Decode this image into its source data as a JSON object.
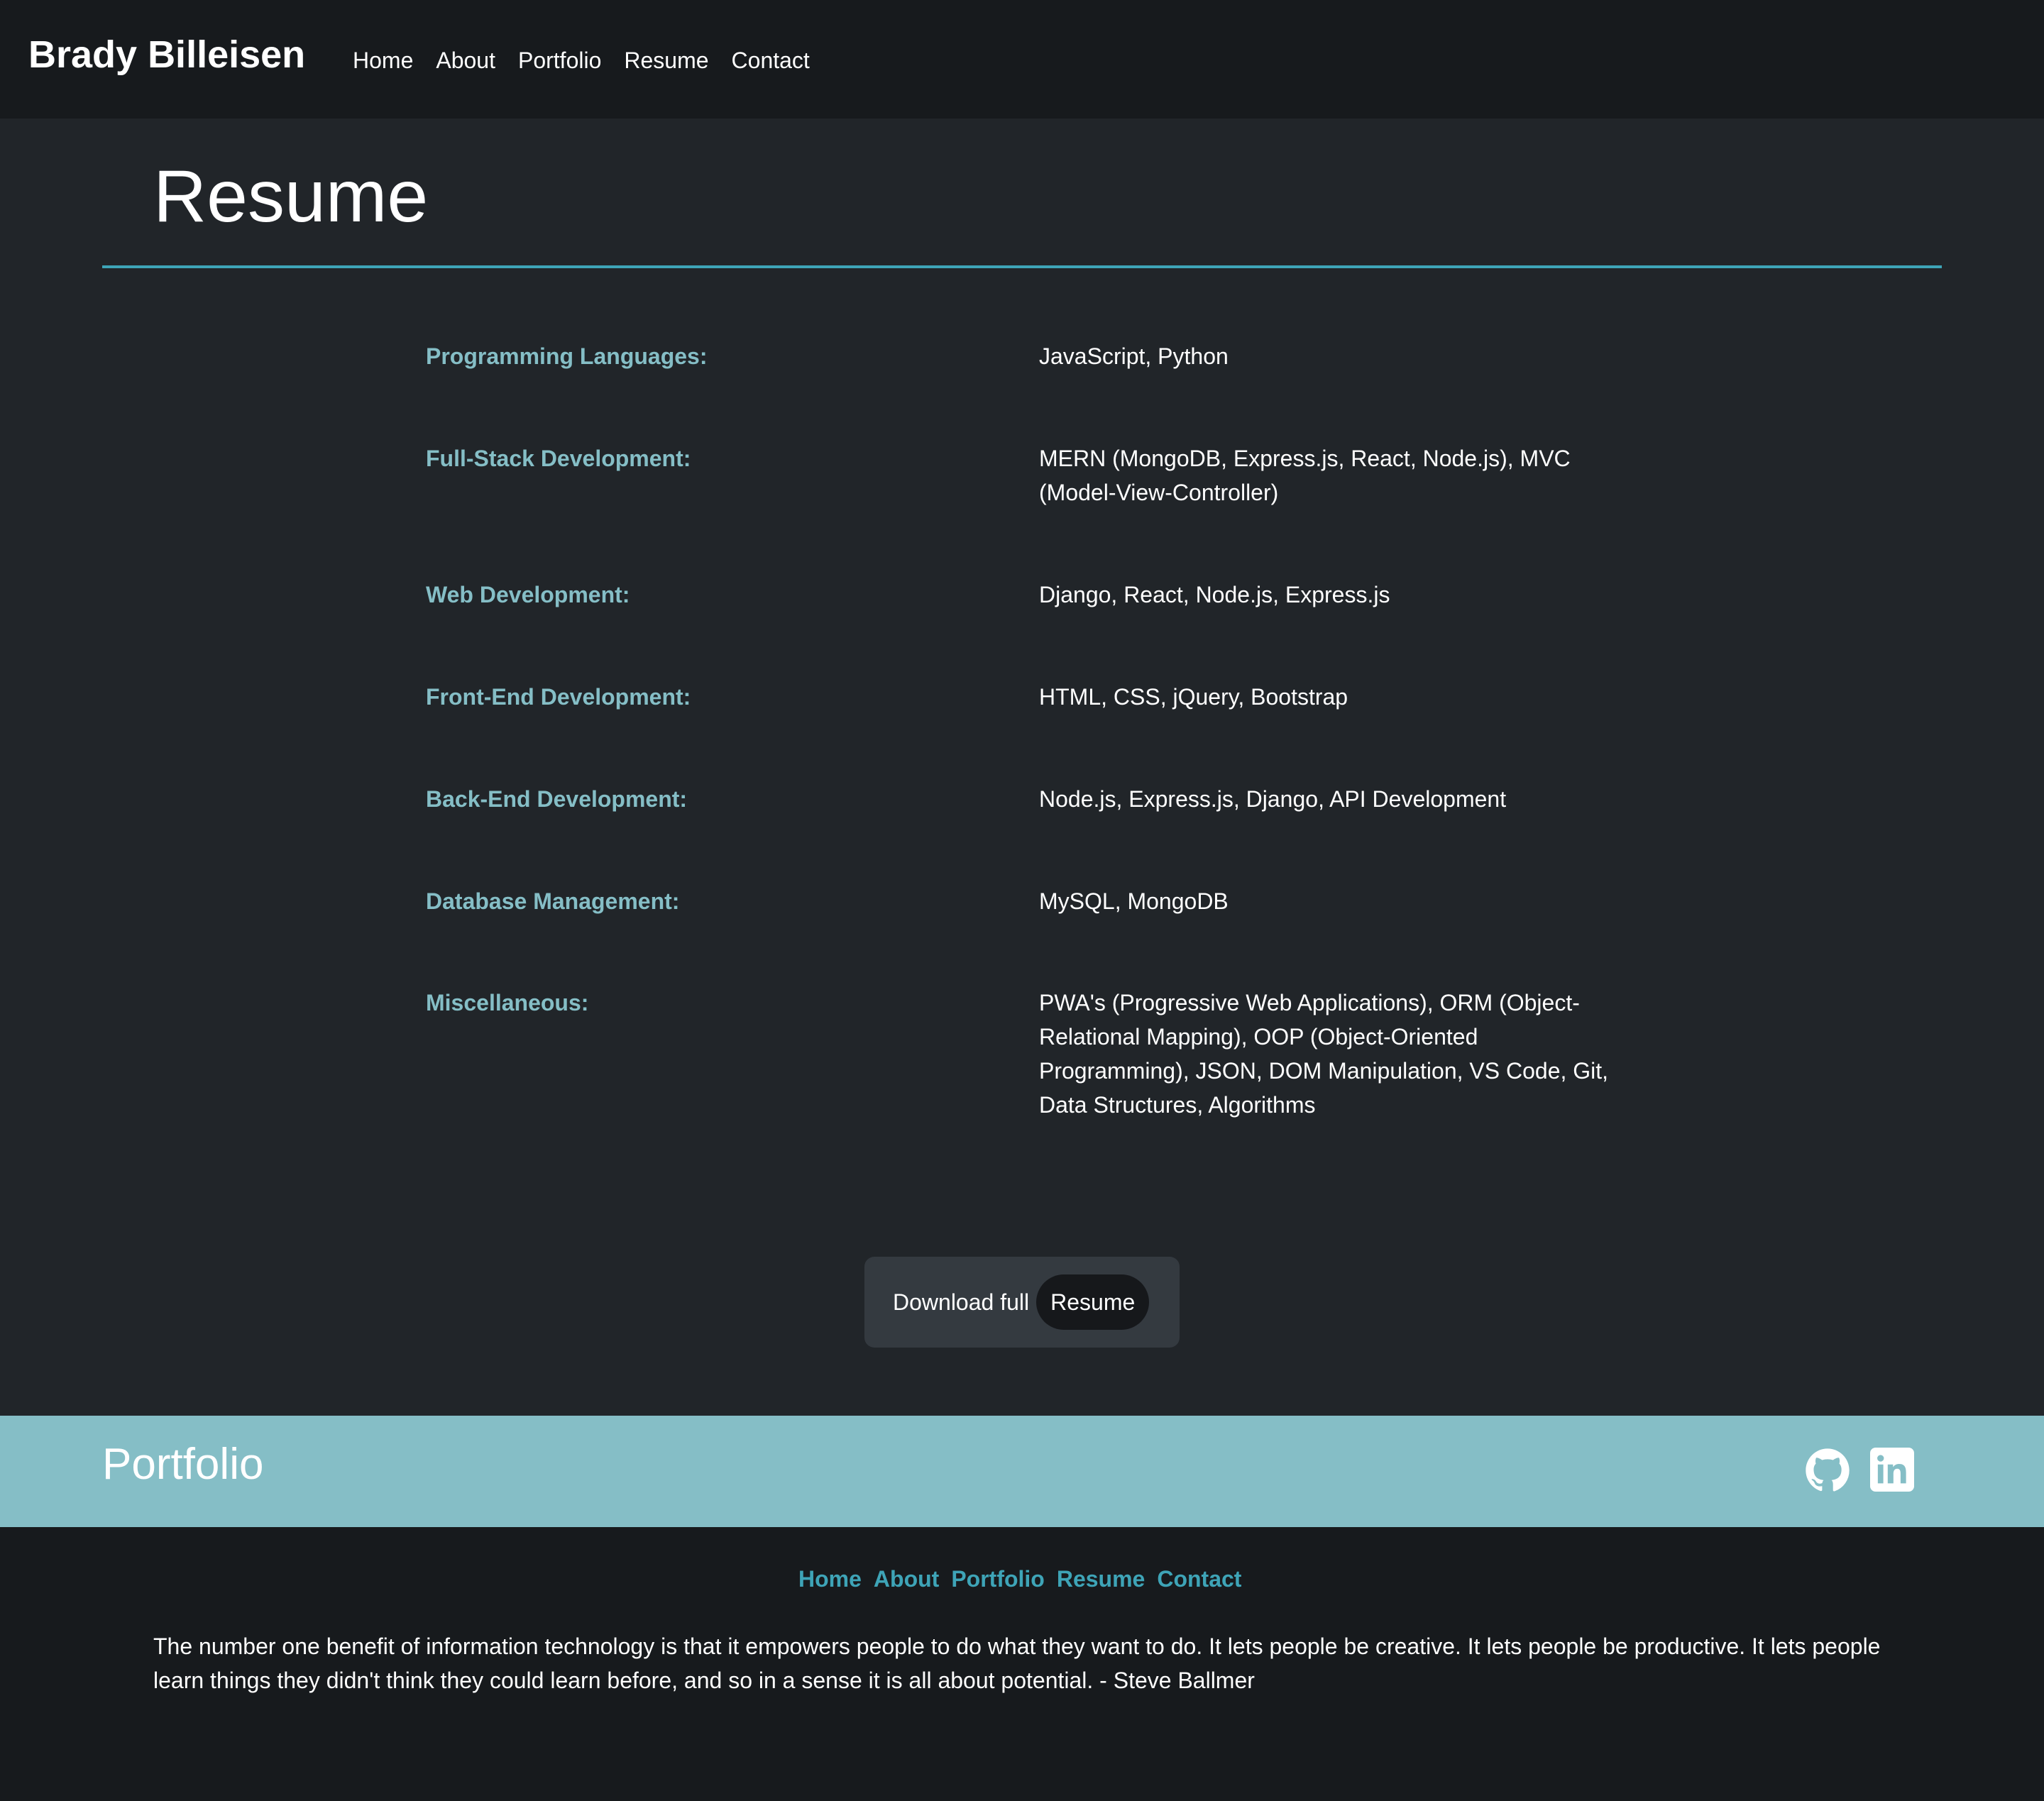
{
  "header": {
    "brand": "Brady Billeisen",
    "nav": [
      "Home",
      "About",
      "Portfolio",
      "Resume",
      "Contact"
    ]
  },
  "main": {
    "title": "Resume",
    "skills": [
      {
        "label": "Programming Languages:",
        "value": "JavaScript, Python"
      },
      {
        "label": "Full-Stack Development:",
        "value": "MERN (MongoDB, Express.js, React, Node.js), MVC (Model-View-Controller)"
      },
      {
        "label": "Web Development:",
        "value": "Django, React, Node.js, Express.js"
      },
      {
        "label": "Front-End Development:",
        "value": "HTML, CSS, jQuery, Bootstrap"
      },
      {
        "label": "Back-End Development:",
        "value": "Node.js, Express.js, Django, API Development"
      },
      {
        "label": "Database Management:",
        "value": "MySQL, MongoDB"
      },
      {
        "label": "Miscellaneous:",
        "value": "PWA's (Progressive Web Applications), ORM (Object-Relational Mapping), OOP (Object-Oriented Programming), JSON, DOM Manipulation, VS Code, Git, Data Structures, Algorithms"
      }
    ],
    "download_text": "Download full",
    "download_button": "Resume"
  },
  "footer": {
    "title": "Portfolio",
    "social_icons": [
      "github-icon",
      "linkedin-icon"
    ],
    "nav": [
      "Home",
      "About",
      "Portfolio",
      "Resume",
      "Contact"
    ],
    "quote": "The number one benefit of information technology is that it empowers people to do what they want to do. It lets people be creative. It lets people be productive. It lets people learn things they didn't think they could learn before, and so in a sense it is all about potential. - Steve Ballmer"
  },
  "colors": {
    "page_bg": "#212529",
    "header_bg": "#171a1d",
    "accent": "#3ea4b7",
    "label": "#85bec6",
    "footer_band": "#85bec6"
  }
}
